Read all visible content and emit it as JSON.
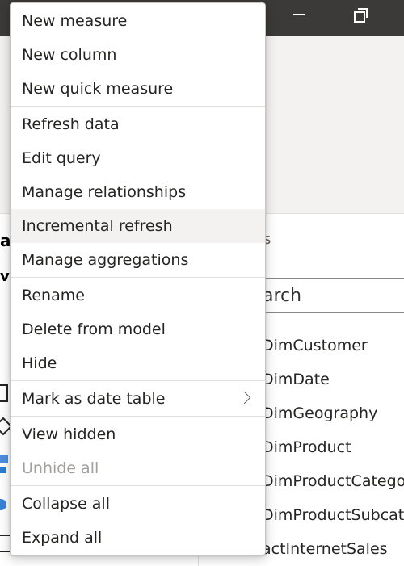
{
  "context_menu": {
    "items": [
      {
        "label": "New measure"
      },
      {
        "label": "New column"
      },
      {
        "label": "New quick measure"
      },
      {
        "label": "Refresh data"
      },
      {
        "label": "Edit query"
      },
      {
        "label": "Manage relationships"
      },
      {
        "label": "Incremental refresh",
        "state": "hover"
      },
      {
        "label": "Manage aggregations"
      },
      {
        "label": "Rename"
      },
      {
        "label": "Delete from model"
      },
      {
        "label": "Hide"
      },
      {
        "label": "Mark as date table",
        "submenu_icon": "chevron-right-icon"
      },
      {
        "label": "View hidden"
      },
      {
        "label": "Unhide all",
        "state": "disabled"
      },
      {
        "label": "Collapse all"
      },
      {
        "label": "Expand all"
      }
    ]
  },
  "background": {
    "left_fragments": {
      "a": "a",
      "vi": "vi"
    },
    "fields_title_fragment": "s",
    "search_value": "arch",
    "field_items": [
      "DimCustomer",
      "DimDate",
      "DimGeography",
      "DimProduct",
      "DimProductCategor",
      "DimProductSubcate",
      "actInternetSales"
    ],
    "window_controls": [
      "minimize-icon",
      "restore-icon"
    ]
  },
  "colors": {
    "titlebar": "#3b3a39",
    "menu_hover": "#f3f2f1",
    "disabled_text": "#a19f9d"
  }
}
